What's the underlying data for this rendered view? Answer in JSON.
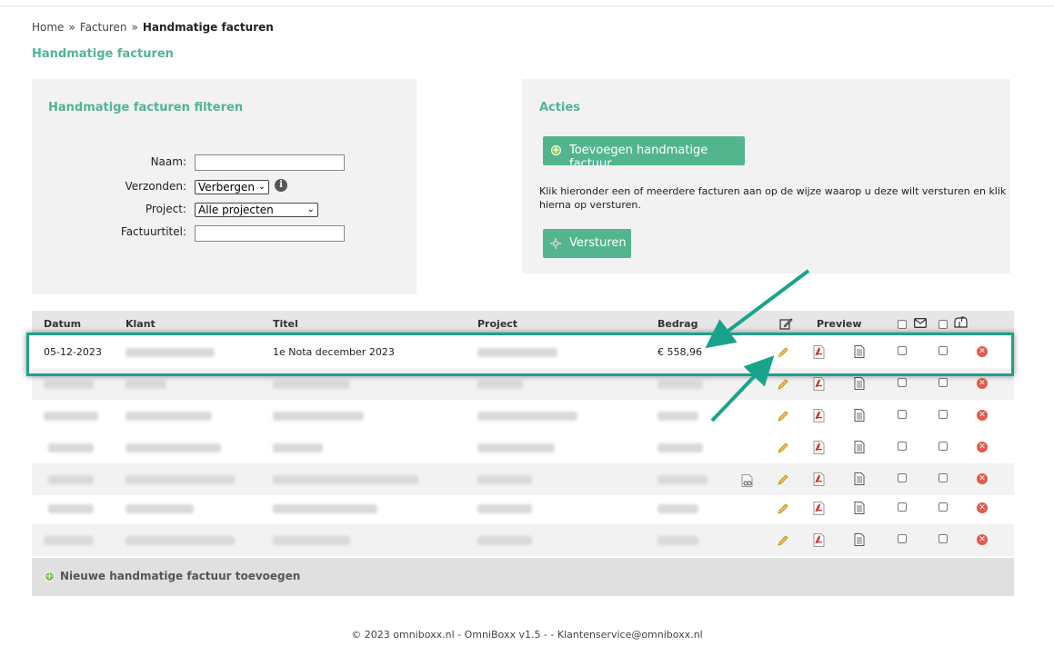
{
  "breadcrumb": {
    "home": "Home",
    "sep": "»",
    "invoices": "Facturen",
    "current": "Handmatige facturen"
  },
  "page_title": "Handmatige facturen",
  "filter": {
    "title": "Handmatige facturen filteren",
    "name_label": "Naam:",
    "name_value": "",
    "sent_label": "Verzonden:",
    "sent_value": "Verbergen",
    "project_label": "Project:",
    "project_value": "Alle projecten",
    "invoice_title_label": "Factuurtitel:",
    "invoice_title_value": ""
  },
  "actions": {
    "title": "Acties",
    "add_button": "Toevoegen handmatige factuur",
    "instruction": "Klik hieronder een of meerdere facturen aan op de wijze waarop u deze wilt versturen en klik hierna op versturen.",
    "send_button": "Versturen"
  },
  "table": {
    "headers": {
      "date": "Datum",
      "client": "Klant",
      "title": "Titel",
      "project": "Project",
      "amount": "Bedrag",
      "preview": "Preview"
    },
    "rows": [
      {
        "date": "05-12-2023",
        "client": "",
        "title": "1e Nota december 2023",
        "project": "",
        "amount": "€ 558,96"
      }
    ]
  },
  "footer": {
    "add_new": "Nieuwe handmatige factuur toevoegen",
    "copyright": "© 2023 omniboxx.nl - OmniBoxx v1.5 - - Klantenservice@omniboxx.nl"
  },
  "colors": {
    "accent": "#52b58e",
    "highlight": "#1aa38b",
    "delete": "#e45a4e"
  }
}
